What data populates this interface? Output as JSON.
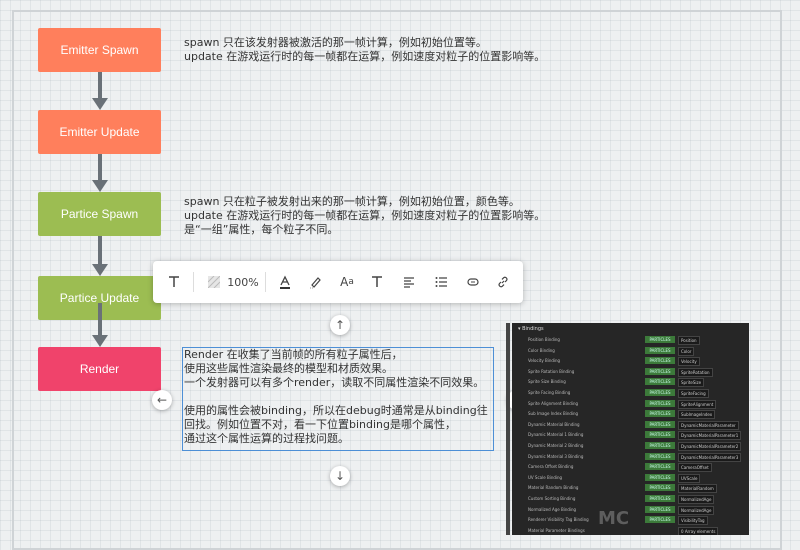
{
  "flow": {
    "nodes": [
      {
        "label": "Emitter Spawn",
        "color": "#ff7f5c"
      },
      {
        "label": "Emitter Update",
        "color": "#ff7f5c"
      },
      {
        "label": "Partice Spawn",
        "color": "#9cbd52"
      },
      {
        "label": "Partice Update",
        "color": "#9cbd52"
      },
      {
        "label": "Render",
        "color": "#f0436b"
      }
    ]
  },
  "notes": {
    "emitter": [
      "spawn 只在该发射器被激活的那一帧计算，例如初始位置等。",
      "update 在游戏运行时的每一帧都在运算，例如速度对粒子的位置影响等。"
    ],
    "particle": [
      "spawn 只在粒子被发射出来的那一帧计算，例如初始位置，颜色等。",
      "update 在游戏运行时的每一帧都在运算，例如速度对粒子的位置影响等。",
      "是“一组”属性，每个粒子不同。"
    ],
    "render": [
      "Render 在收集了当前帧的所有粒子属性后，",
      "使用这些属性渲染最终的模型和材质效果。",
      "一个发射器可以有多个render，读取不同属性渲染不同效果。",
      "",
      "使用的属性会被binding，所以在debug时通常是从binding往",
      "回找。例如位置不对，看一下位置binding是哪个属性，",
      "通过这个属性运算的过程找问题。"
    ]
  },
  "toolbar": {
    "zoom": "100%",
    "icons": [
      "text-type-icon",
      "fill-pattern-icon",
      "font-color-icon",
      "highlight-pen-icon",
      "font-size-icon",
      "text-style-icon",
      "align-left-icon",
      "list-icon",
      "ellipse-icon",
      "link-icon"
    ]
  },
  "panel": {
    "title": "▾ Bindings",
    "tag": "PARTICLES",
    "rows": [
      {
        "label": "Position Binding",
        "value": "Position"
      },
      {
        "label": "Color Binding",
        "value": "Color"
      },
      {
        "label": "Velocity Binding",
        "value": "Velocity"
      },
      {
        "label": "Sprite Rotation Binding",
        "value": "SpriteRotation"
      },
      {
        "label": "Sprite Size Binding",
        "value": "SpriteSize"
      },
      {
        "label": "Sprite Facing Binding",
        "value": "SpriteFacing"
      },
      {
        "label": "Sprite Alignment Binding",
        "value": "SpriteAlignment"
      },
      {
        "label": "Sub Image Index Binding",
        "value": "SubImageIndex"
      },
      {
        "label": "Dynamic Material Binding",
        "value": "DynamicMaterialParameter"
      },
      {
        "label": "Dynamic Material 1 Binding",
        "value": "DynamicMaterialParameter1"
      },
      {
        "label": "Dynamic Material 2 Binding",
        "value": "DynamicMaterialParameter2"
      },
      {
        "label": "Dynamic Material 3 Binding",
        "value": "DynamicMaterialParameter3"
      },
      {
        "label": "Camera Offset Binding",
        "value": "CameraOffset"
      },
      {
        "label": "UV Scale Binding",
        "value": "UVScale"
      },
      {
        "label": "Material Random Binding",
        "value": "MaterialRandom"
      },
      {
        "label": "Custom Sorting Binding",
        "value": "NormalizedAge"
      },
      {
        "label": "Normalized Age Binding",
        "value": "NormalizedAge"
      },
      {
        "label": "Renderer Visibility Tag Binding",
        "value": "VisibilityTag"
      },
      {
        "label": "Material Parameter Bindings",
        "value": "0 Array elements"
      }
    ]
  },
  "watermark": "MC"
}
